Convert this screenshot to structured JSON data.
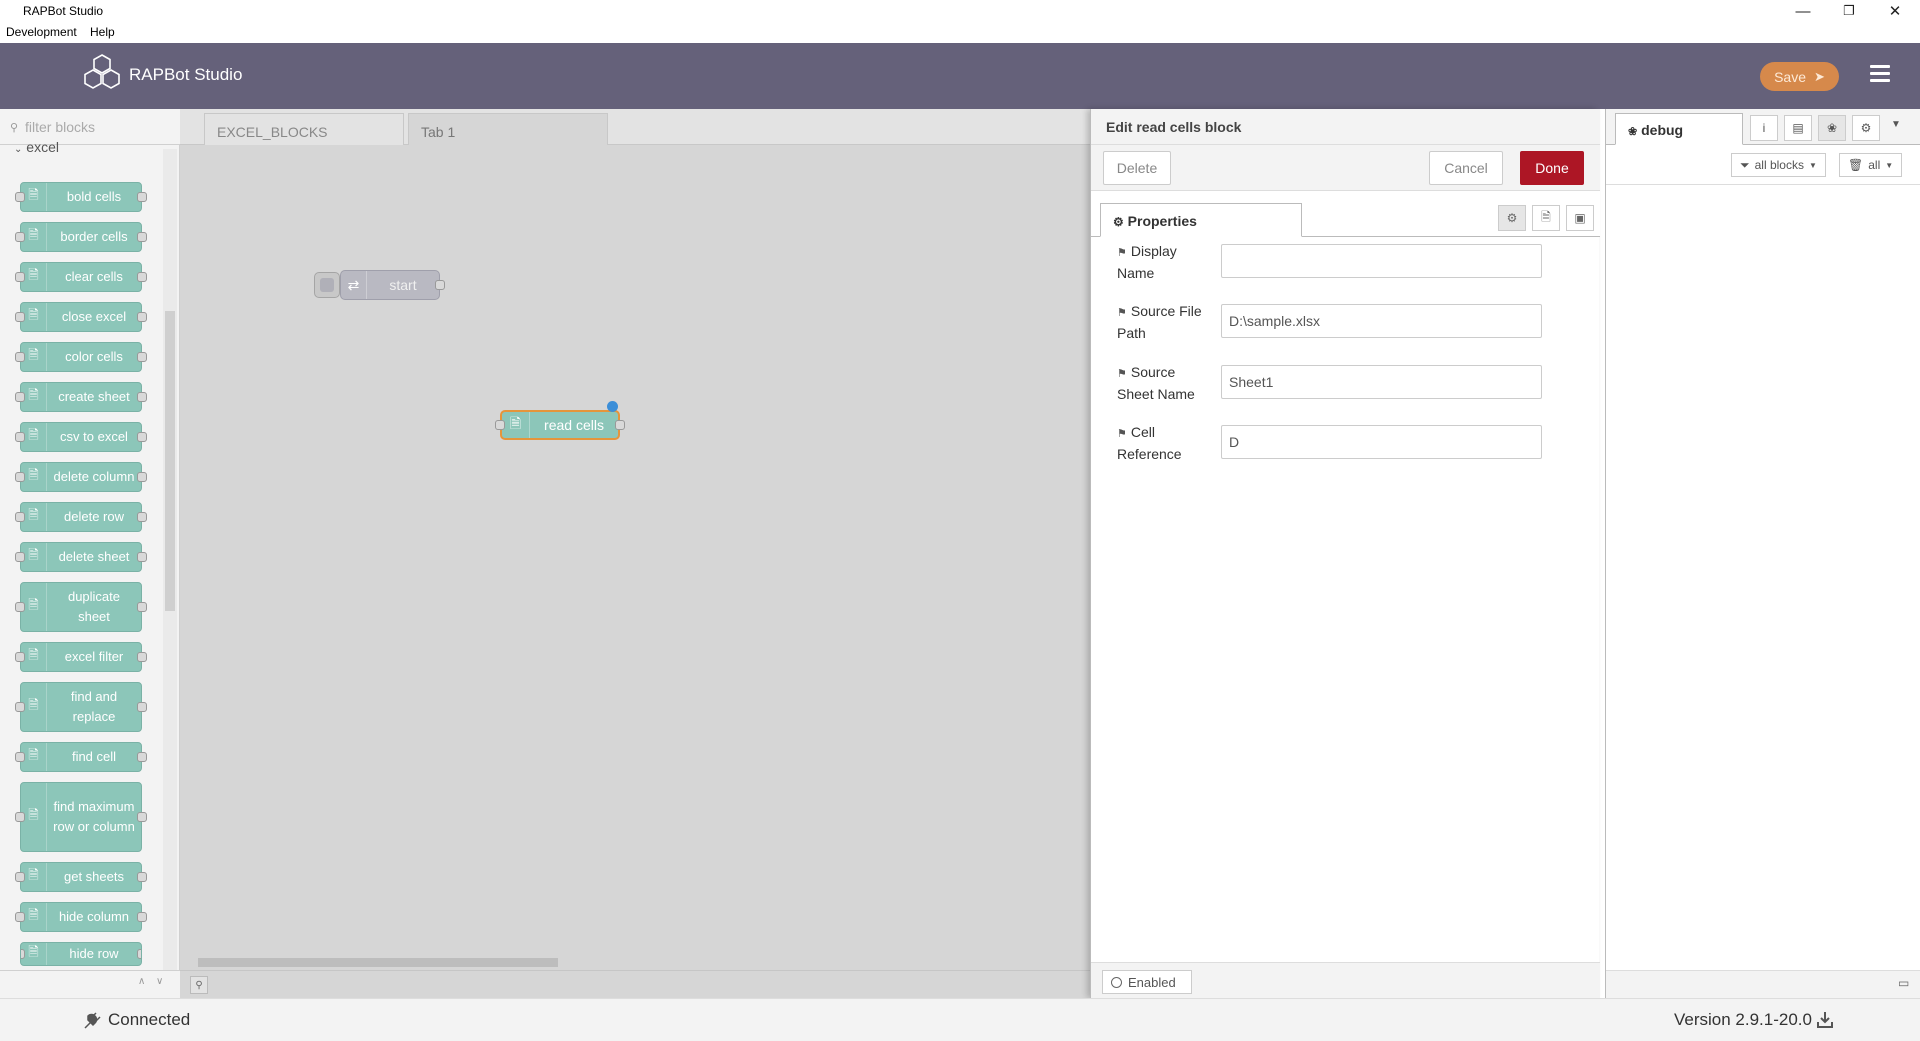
{
  "window": {
    "title": "RAPBot Studio"
  },
  "menu": [
    "Development",
    "Help"
  ],
  "header": {
    "app_name": "RAPBot Studio",
    "save_label": "Save"
  },
  "palette": {
    "filter_placeholder": "filter blocks",
    "category": "excel",
    "blocks": [
      "bold cells",
      "border cells",
      "clear cells",
      "close excel",
      "color cells",
      "create sheet",
      "csv to excel",
      "delete column",
      "delete row",
      "delete sheet",
      "duplicate sheet",
      "excel filter",
      "find and replace",
      "find cell",
      "find maximum row or column",
      "get sheets",
      "hide column",
      "hide row"
    ]
  },
  "workspace": {
    "tabs": [
      "EXCEL_BLOCKS",
      "Tab 1"
    ],
    "active_tab": "Tab 1",
    "nodes": {
      "start": "start",
      "read": "read cells"
    }
  },
  "tray": {
    "title": "Edit read cells block",
    "delete_label": "Delete",
    "cancel_label": "Cancel",
    "done_label": "Done",
    "properties_tab": "Properties",
    "fields": {
      "display_name": {
        "label_1": "Display",
        "label_2": "Name",
        "value": ""
      },
      "source_path": {
        "label_1": "Source File",
        "label_2": "Path",
        "value": "D:\\sample.xlsx"
      },
      "sheet_name": {
        "label_1": "Source",
        "label_2": "Sheet Name",
        "value": "Sheet1"
      },
      "cell_ref": {
        "label_1": "Cell",
        "label_2": "Reference",
        "value": "D"
      }
    },
    "enabled_label": "Enabled"
  },
  "sidebar": {
    "tab": "debug",
    "filter_label": "all blocks",
    "clear_label": "all"
  },
  "status": {
    "connection": "Connected",
    "version": "Version 2.9.1-20.0"
  },
  "colors": {
    "header": "#65617a",
    "save": "#d6894b",
    "done": "#ad1625",
    "block": "#8cc6b9",
    "selected_border": "#e5953b"
  }
}
